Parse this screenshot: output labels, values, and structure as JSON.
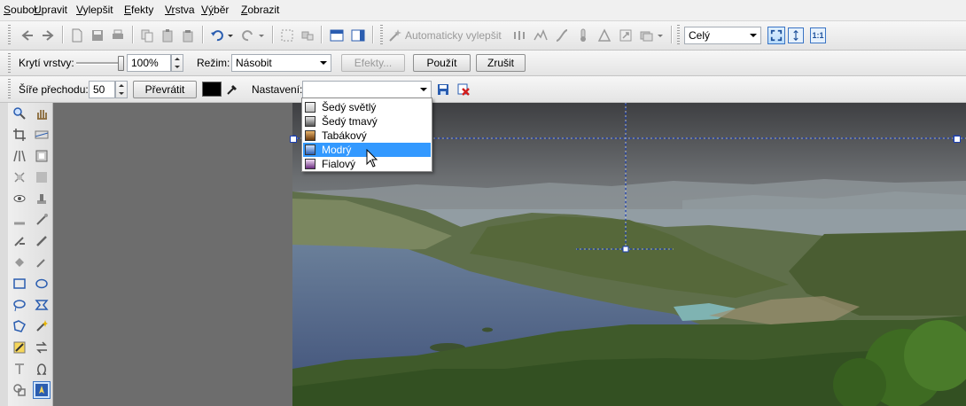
{
  "menu": [
    {
      "accel": "S",
      "rest": "oubor"
    },
    {
      "accel": "U",
      "rest": "pravit"
    },
    {
      "accel": "V",
      "rest": "ylepšit"
    },
    {
      "accel": "E",
      "rest": "fekty"
    },
    {
      "accel": "Vr",
      "rest": "stva"
    },
    {
      "accel": "Vý",
      "rest": "běr"
    },
    {
      "accel": "Z",
      "rest": "obrazit"
    }
  ],
  "toolbar1": {
    "auto_enhance_label": "Automaticky vylepšit",
    "zoom_value": "Celý",
    "zoom_1to1": "1:1"
  },
  "toolbar2": {
    "opacity_label": "Krytí vrstvy:",
    "opacity_value": "100%",
    "opacity_level": 1.0,
    "mode_label": "Režim:",
    "mode_value": "Násobit",
    "effects_label": "Efekty...",
    "apply_label": "Použít",
    "cancel_label": "Zrušit"
  },
  "toolbar3": {
    "gradient_width_label": "Šíře přechodu:",
    "gradient_width_value": "50",
    "invert_label": "Převrátit",
    "color_value": "#000000",
    "preset_label": "Nastavení:",
    "preset_value": ""
  },
  "dropdown": {
    "items": [
      {
        "label": "Šedý světlý",
        "colors": [
          "#f4f4f4",
          "#bdbdbd"
        ],
        "selected": false
      },
      {
        "label": "Šedý tmavý",
        "colors": [
          "#e6e6e6",
          "#555555"
        ],
        "selected": false
      },
      {
        "label": "Tabákový",
        "colors": [
          "#e9b36a",
          "#6b3a0d"
        ],
        "selected": false
      },
      {
        "label": "Modrý",
        "colors": [
          "#cfe3ff",
          "#2c5fb2"
        ],
        "selected": true
      },
      {
        "label": "Fialový",
        "colors": [
          "#f1dcf3",
          "#6a2c80"
        ],
        "selected": false
      }
    ]
  },
  "colors": {
    "selection_blue": "#3399ff",
    "canvas_bg": "#6d6d6d"
  }
}
